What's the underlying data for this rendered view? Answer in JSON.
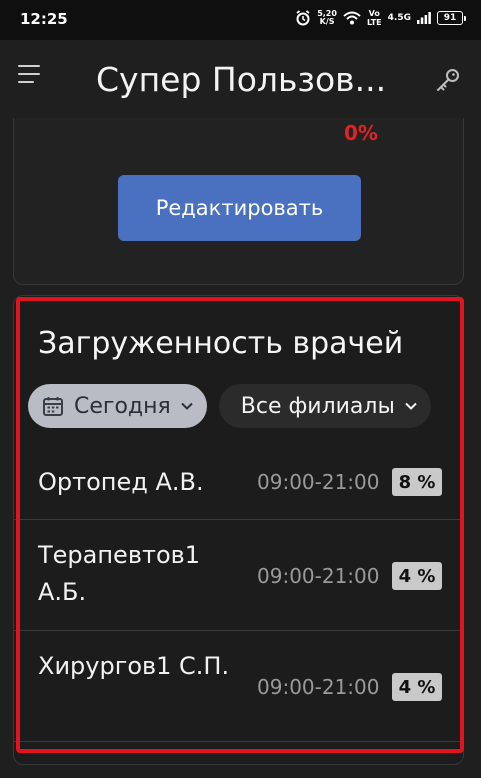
{
  "status_bar": {
    "time": "12:25",
    "net_speed_value": "5,20",
    "net_speed_unit": "K/S",
    "vo_label": "Vo",
    "lte_label": "LTE",
    "network_type": "4.5G",
    "battery_level": "91"
  },
  "app_bar": {
    "title": "Супер Пользов...",
    "menu_icon": "hamburger-icon",
    "key_icon": "key-icon"
  },
  "top_card": {
    "percent": "0%",
    "edit_label": "Редактировать",
    "percent_color": "#e02424",
    "button_color": "#4a71bf"
  },
  "workload": {
    "title": "Загруженность врачей",
    "filter_date": "Сегодня",
    "filter_branch": "Все филиалы",
    "doctors": [
      {
        "name": "Ортопед А.В.",
        "hours": "09:00-21:00",
        "load": "8 %"
      },
      {
        "name": "Терапевтов1 А.Б.",
        "hours": "09:00-21:00",
        "load": "4 %"
      },
      {
        "name": "Хирургов1 С.П.",
        "hours": "09:00-21:00",
        "load": "4 %"
      }
    ]
  },
  "colors": {
    "background": "#1f1f1f",
    "highlight": "#e0141e",
    "chip_active": "#b9bcc4"
  }
}
